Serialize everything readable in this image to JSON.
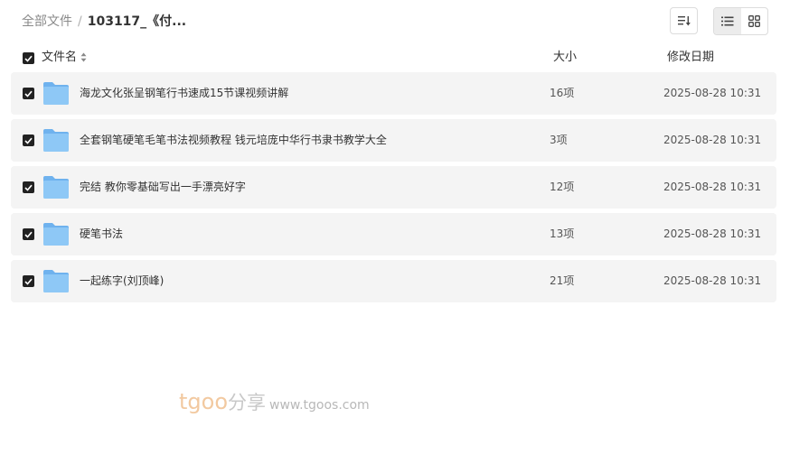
{
  "breadcrumb": {
    "root": "全部文件",
    "separator": "/",
    "current": "103117_《付..."
  },
  "toolbar": {
    "sort_icon": "sort-icon",
    "list_view_icon": "list-view-icon",
    "grid_view_icon": "grid-view-icon",
    "active_view": "list"
  },
  "table": {
    "columns": {
      "name": "文件名",
      "size": "大小",
      "modified": "修改日期"
    },
    "all_selected": true,
    "rows": [
      {
        "name": "海龙文化张呈钢笔行书速成15节课视频讲解",
        "size": "16项",
        "modified": "2025-08-28 10:31",
        "selected": true
      },
      {
        "name": "全套钢笔硬笔毛笔书法视频教程 钱元培庞中华行书隶书教学大全",
        "size": "3项",
        "modified": "2025-08-28 10:31",
        "selected": true
      },
      {
        "name": "完结 教你零基础写出一手漂亮好字",
        "size": "12项",
        "modified": "2025-08-28 10:31",
        "selected": true
      },
      {
        "name": "硬笔书法",
        "size": "13项",
        "modified": "2025-08-28 10:31",
        "selected": true
      },
      {
        "name": "一起练字(刘顶峰)",
        "size": "21项",
        "modified": "2025-08-28 10:31",
        "selected": true
      }
    ]
  },
  "watermark": {
    "brand": "tgoo",
    "cn": "分享",
    "url": "www.tgoos.com"
  },
  "colors": {
    "folder": "#7cbcf2",
    "row_bg": "#f4f4f4",
    "checkbox": "#222222"
  }
}
